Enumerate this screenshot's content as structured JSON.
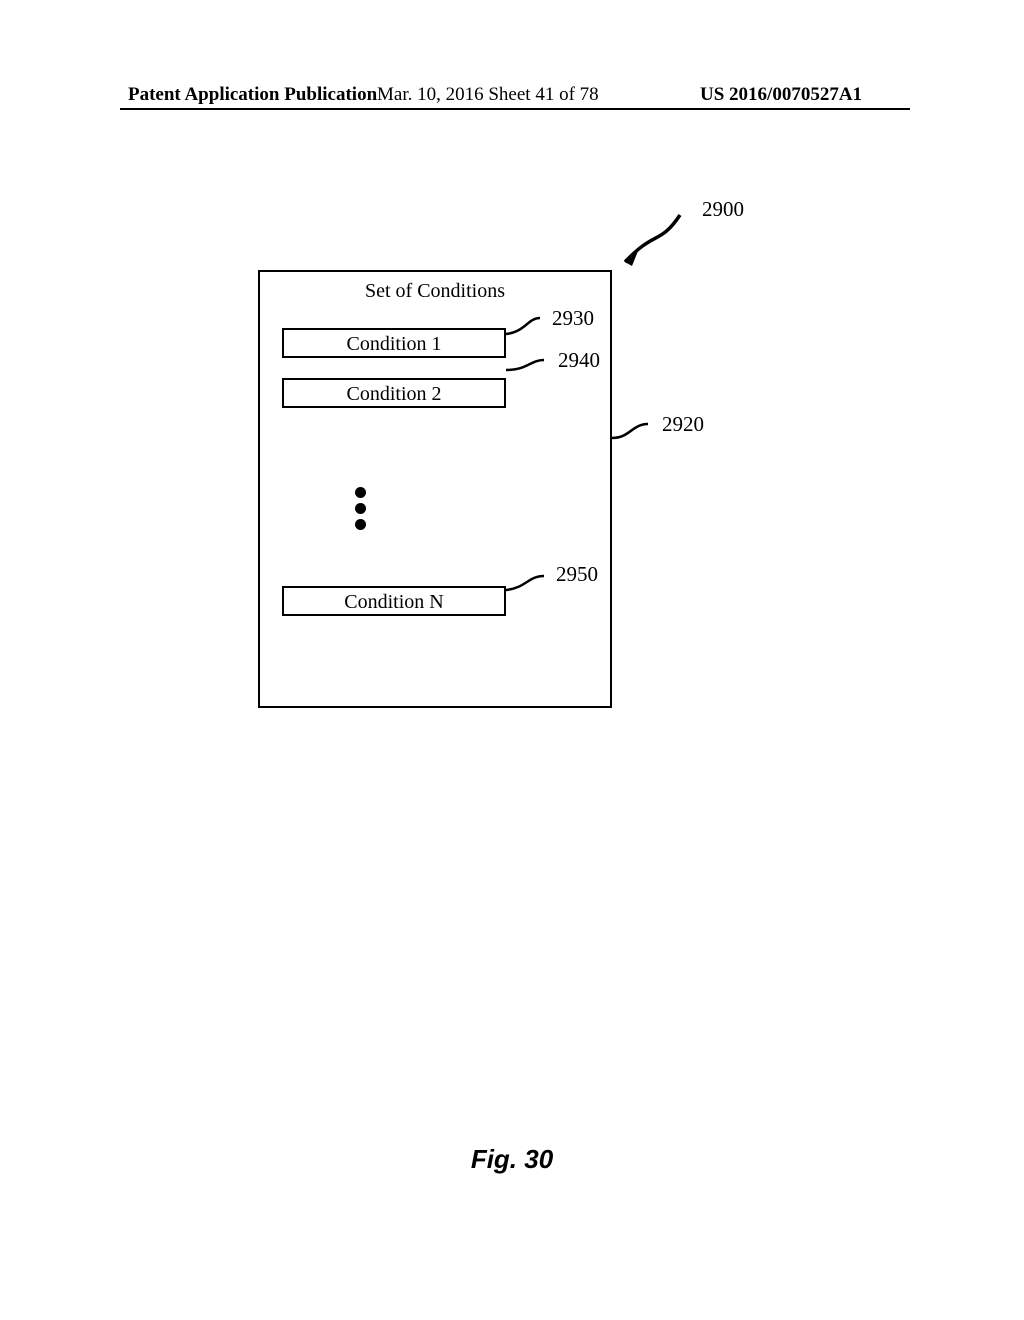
{
  "header": {
    "left": "Patent Application Publication",
    "mid": "Mar. 10, 2016  Sheet 41 of 78",
    "right": "US 2016/0070527A1"
  },
  "diagram": {
    "outer_title": "Set of Conditions",
    "conditions": {
      "c1": "Condition 1",
      "c2": "Condition 2",
      "cN": "Condition N"
    },
    "labels": {
      "r2900": "2900",
      "r2920": "2920",
      "r2930": "2930",
      "r2940": "2940",
      "r2950": "2950"
    }
  },
  "figure_caption": "Fig. 30"
}
